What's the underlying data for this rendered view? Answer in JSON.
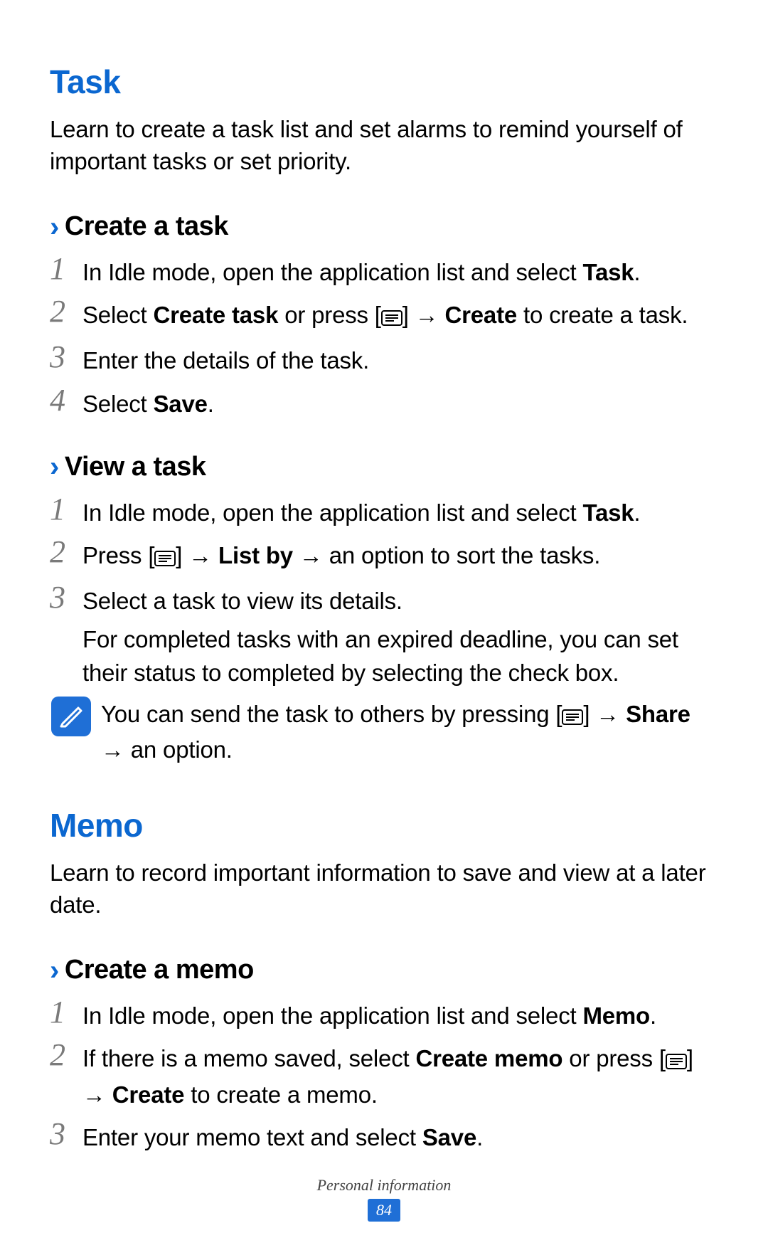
{
  "section1": {
    "heading": "Task",
    "intro": "Learn to create a task list and set alarms to remind yourself of important tasks or set priority.",
    "sub1": {
      "title": "Create a task",
      "steps": {
        "s1_pre": "In Idle mode, open the application list and select ",
        "s1_b": "Task",
        "s1_post": ".",
        "s2_pre": "Select ",
        "s2_b1": "Create task",
        "s2_mid": " or press [",
        "s2_arrow": "] → ",
        "s2_b2": "Create",
        "s2_post": " to create a task.",
        "s3": "Enter the details of the task.",
        "s4_pre": "Select ",
        "s4_b": "Save",
        "s4_post": "."
      }
    },
    "sub2": {
      "title": "View a task",
      "steps": {
        "s1_pre": "In Idle mode, open the application list and select ",
        "s1_b": "Task",
        "s1_post": ".",
        "s2_pre": "Press [",
        "s2_arrow1": "] → ",
        "s2_b": "List by",
        "s2_arrow2": " → an option to sort the tasks.",
        "s3": "Select a task to view its details.",
        "s3_extra": "For completed tasks with an expired deadline, you can set their status to completed by selecting the check box."
      },
      "note": {
        "pre": "You can send the task to others by pressing [",
        "arrow": "] → ",
        "b": "Share",
        "post": " → an option."
      }
    }
  },
  "section2": {
    "heading": "Memo",
    "intro": "Learn to record important information to save and view at a later date.",
    "sub1": {
      "title": "Create a memo",
      "steps": {
        "s1_pre": "In Idle mode, open the application list and select ",
        "s1_b": "Memo",
        "s1_post": ".",
        "s2_pre": "If there is a memo saved, select ",
        "s2_b1": "Create memo",
        "s2_mid": " or press [",
        "s2_arrow": "] → ",
        "s2_b2": "Create",
        "s2_post": " to create a memo.",
        "s3_pre": "Enter your memo text and select ",
        "s3_b": "Save",
        "s3_post": "."
      }
    }
  },
  "nums": {
    "n1": "1",
    "n2": "2",
    "n3": "3",
    "n4": "4"
  },
  "chev": "›",
  "footer": {
    "label": "Personal information",
    "page": "84"
  }
}
